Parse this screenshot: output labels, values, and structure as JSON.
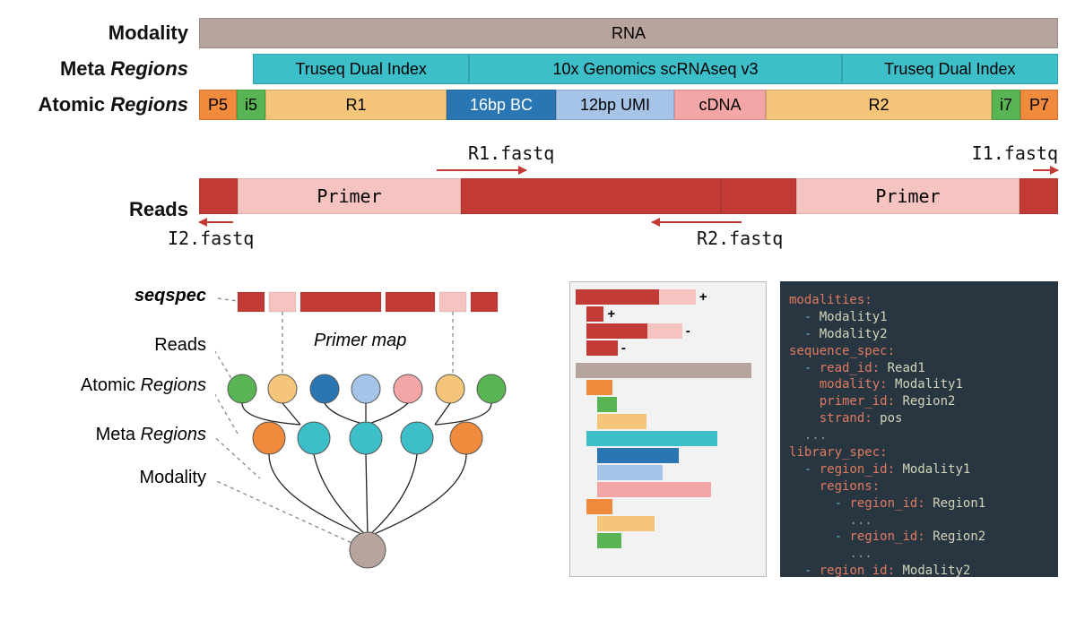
{
  "rows": {
    "modality_label": "Modality",
    "modality_bar": "RNA",
    "meta_label_prefix": "Meta ",
    "meta_label_italic": "Regions",
    "meta": [
      "Truseq Dual Index",
      "10x Genomics scRNAseq v3",
      "Truseq Dual Index"
    ],
    "atomic_label_prefix": "Atomic ",
    "atomic_label_italic": "Regions",
    "atomic": [
      "P5",
      "i5",
      "R1",
      "16bp BC",
      "12bp UMI",
      "cDNA",
      "R2",
      "i7",
      "P7"
    ]
  },
  "reads": {
    "label": "Reads",
    "top_left": "R1.fastq",
    "top_right": "I1.fastq",
    "bot_left": "I2.fastq",
    "bot_right": "R2.fastq",
    "primer": "Primer"
  },
  "tree": {
    "seqspec": "seqspec",
    "reads": "Reads",
    "atomic_prefix": "Atomic ",
    "atomic_italic": "Regions",
    "meta_prefix": "Meta ",
    "meta_italic": "Regions",
    "modality": "Modality",
    "primer_map": "Primer map",
    "mid_plus": "+",
    "mid_minus": "-"
  },
  "code": {
    "l1": "modalities:",
    "l2": "- Modality1",
    "l3": "- Modality2",
    "l4": "sequence_spec:",
    "l5": "- read_id: Read1",
    "l6": "modality: Modality1",
    "l7": "primer_id: Region2",
    "l8": "strand: pos",
    "l9": "...",
    "l10": "library_spec:",
    "l11": "- region_id: Modality1",
    "l12": "regions:",
    "l13": "- region_id: Region1",
    "l14": "...",
    "l15": "- region_id: Region2",
    "l16": "...",
    "l17": "- region_id: Modality2",
    "l18": "..."
  }
}
